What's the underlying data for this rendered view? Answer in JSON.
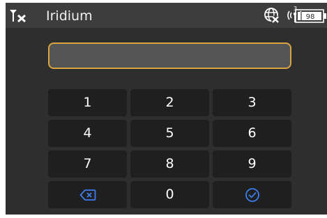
{
  "status_bar": {
    "title": "Iridium",
    "battery_level": "98",
    "icons": [
      "no-signal-icon",
      "globe-icon",
      "satellite-signal-icon",
      "battery-icon"
    ]
  },
  "input": {
    "value": ""
  },
  "keypad": {
    "keys": [
      "1",
      "2",
      "3",
      "4",
      "5",
      "6",
      "7",
      "8",
      "9",
      "0"
    ],
    "backspace_icon": "backspace-icon",
    "confirm_icon": "check-circle-icon"
  },
  "colors": {
    "background": "#2e2e2e",
    "status_bar": "#3d3d3d",
    "key": "#1f1f1f",
    "input_border": "#d9a441",
    "input_fill": "#545454",
    "accent": "#3d7ff0"
  }
}
